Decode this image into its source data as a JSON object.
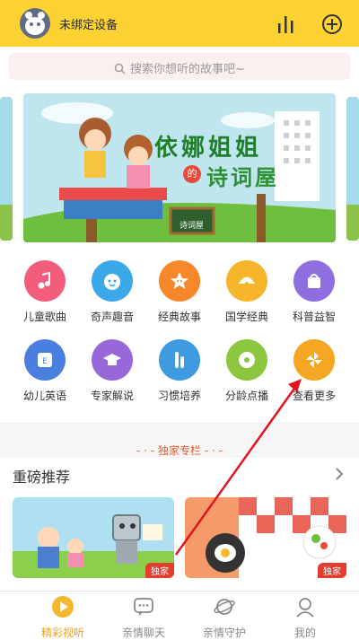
{
  "header": {
    "device_label": "未绑定设备",
    "chart_icon": "bar-chart-icon",
    "add_icon": "plus-circle-icon"
  },
  "search": {
    "placeholder": "搜索你想听的故事吧~"
  },
  "banner": {
    "title": "依娜姐姐",
    "connector": "的",
    "subtitle": "诗词屋",
    "board_text": "诗词屋"
  },
  "categories": [
    {
      "label": "儿童歌曲",
      "color": "#f25d7c",
      "icon": "music-note-icon"
    },
    {
      "label": "奇声趣音",
      "color": "#3ba8e8",
      "icon": "baby-face-icon"
    },
    {
      "label": "经典故事",
      "color": "#f7872b",
      "icon": "star-face-icon"
    },
    {
      "label": "国学经典",
      "color": "#f7b52c",
      "icon": "fan-icon"
    },
    {
      "label": "科普益智",
      "color": "#8f6ee0",
      "icon": "bag-icon"
    },
    {
      "label": "幼儿英语",
      "color": "#4a7fe0",
      "icon": "abc-icon"
    },
    {
      "label": "专家解说",
      "color": "#9968d8",
      "icon": "graduation-cap-icon"
    },
    {
      "label": "习惯培养",
      "color": "#3e9be0",
      "icon": "toothbrush-icon"
    },
    {
      "label": "分龄点播",
      "color": "#8cc63f",
      "icon": "disc-icon"
    },
    {
      "label": "查看更多",
      "color": "#f5a623",
      "icon": "pinwheel-icon"
    }
  ],
  "section_tag": "独家专栏",
  "recommend": {
    "title": "重磅推荐",
    "more_icon": "chevron-right-icon",
    "cards": [
      {
        "badge": "独家"
      },
      {
        "badge": "独家"
      }
    ]
  },
  "tabs": [
    {
      "label": "精彩视听",
      "icon": "play-circle-icon",
      "active": true
    },
    {
      "label": "亲情聊天",
      "icon": "chat-bubble-icon",
      "active": false
    },
    {
      "label": "亲情守护",
      "icon": "planet-icon",
      "active": false
    },
    {
      "label": "我的",
      "icon": "person-icon",
      "active": false
    }
  ],
  "colors": {
    "accent": "#fdd233",
    "active_tab": "#f0a21a",
    "badge": "#e23d2f",
    "annotation_arrow": "#e0141e"
  }
}
